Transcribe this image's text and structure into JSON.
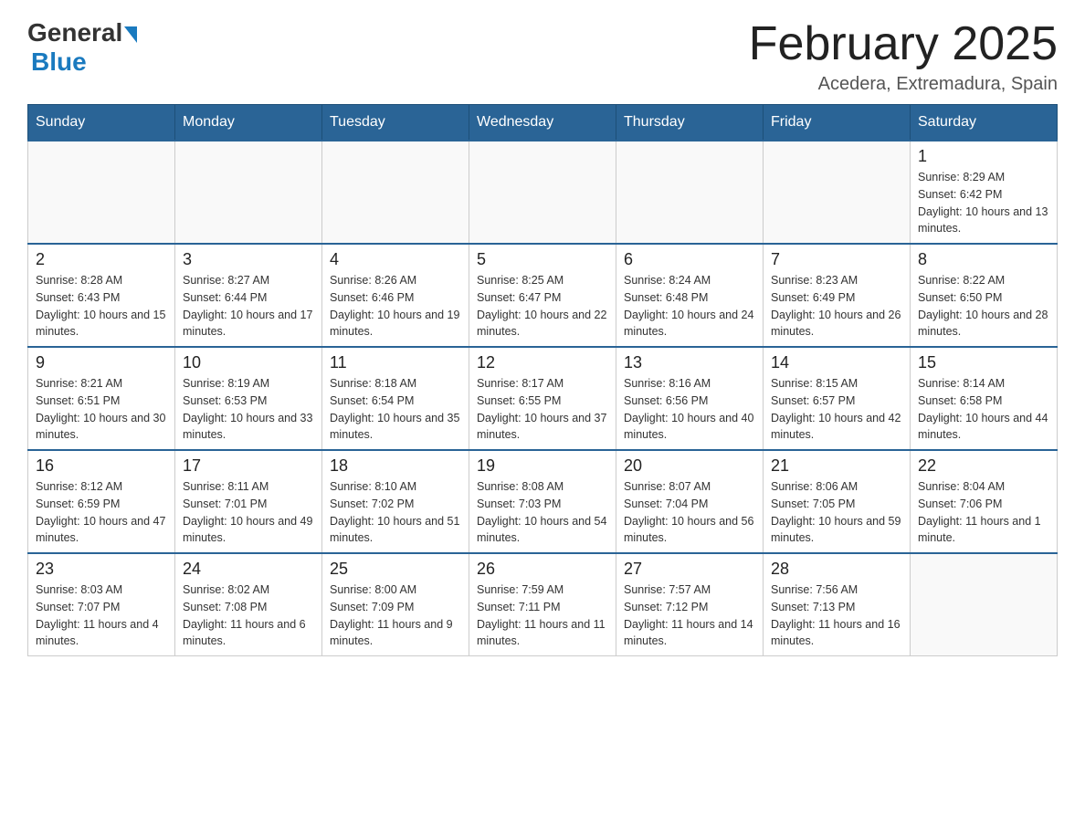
{
  "header": {
    "logo_general": "General",
    "logo_blue": "Blue",
    "title": "February 2025",
    "location": "Acedera, Extremadura, Spain"
  },
  "days_of_week": [
    "Sunday",
    "Monday",
    "Tuesday",
    "Wednesday",
    "Thursday",
    "Friday",
    "Saturday"
  ],
  "weeks": [
    [
      {
        "day": "",
        "info": ""
      },
      {
        "day": "",
        "info": ""
      },
      {
        "day": "",
        "info": ""
      },
      {
        "day": "",
        "info": ""
      },
      {
        "day": "",
        "info": ""
      },
      {
        "day": "",
        "info": ""
      },
      {
        "day": "1",
        "info": "Sunrise: 8:29 AM\nSunset: 6:42 PM\nDaylight: 10 hours and 13 minutes."
      }
    ],
    [
      {
        "day": "2",
        "info": "Sunrise: 8:28 AM\nSunset: 6:43 PM\nDaylight: 10 hours and 15 minutes."
      },
      {
        "day": "3",
        "info": "Sunrise: 8:27 AM\nSunset: 6:44 PM\nDaylight: 10 hours and 17 minutes."
      },
      {
        "day": "4",
        "info": "Sunrise: 8:26 AM\nSunset: 6:46 PM\nDaylight: 10 hours and 19 minutes."
      },
      {
        "day": "5",
        "info": "Sunrise: 8:25 AM\nSunset: 6:47 PM\nDaylight: 10 hours and 22 minutes."
      },
      {
        "day": "6",
        "info": "Sunrise: 8:24 AM\nSunset: 6:48 PM\nDaylight: 10 hours and 24 minutes."
      },
      {
        "day": "7",
        "info": "Sunrise: 8:23 AM\nSunset: 6:49 PM\nDaylight: 10 hours and 26 minutes."
      },
      {
        "day": "8",
        "info": "Sunrise: 8:22 AM\nSunset: 6:50 PM\nDaylight: 10 hours and 28 minutes."
      }
    ],
    [
      {
        "day": "9",
        "info": "Sunrise: 8:21 AM\nSunset: 6:51 PM\nDaylight: 10 hours and 30 minutes."
      },
      {
        "day": "10",
        "info": "Sunrise: 8:19 AM\nSunset: 6:53 PM\nDaylight: 10 hours and 33 minutes."
      },
      {
        "day": "11",
        "info": "Sunrise: 8:18 AM\nSunset: 6:54 PM\nDaylight: 10 hours and 35 minutes."
      },
      {
        "day": "12",
        "info": "Sunrise: 8:17 AM\nSunset: 6:55 PM\nDaylight: 10 hours and 37 minutes."
      },
      {
        "day": "13",
        "info": "Sunrise: 8:16 AM\nSunset: 6:56 PM\nDaylight: 10 hours and 40 minutes."
      },
      {
        "day": "14",
        "info": "Sunrise: 8:15 AM\nSunset: 6:57 PM\nDaylight: 10 hours and 42 minutes."
      },
      {
        "day": "15",
        "info": "Sunrise: 8:14 AM\nSunset: 6:58 PM\nDaylight: 10 hours and 44 minutes."
      }
    ],
    [
      {
        "day": "16",
        "info": "Sunrise: 8:12 AM\nSunset: 6:59 PM\nDaylight: 10 hours and 47 minutes."
      },
      {
        "day": "17",
        "info": "Sunrise: 8:11 AM\nSunset: 7:01 PM\nDaylight: 10 hours and 49 minutes."
      },
      {
        "day": "18",
        "info": "Sunrise: 8:10 AM\nSunset: 7:02 PM\nDaylight: 10 hours and 51 minutes."
      },
      {
        "day": "19",
        "info": "Sunrise: 8:08 AM\nSunset: 7:03 PM\nDaylight: 10 hours and 54 minutes."
      },
      {
        "day": "20",
        "info": "Sunrise: 8:07 AM\nSunset: 7:04 PM\nDaylight: 10 hours and 56 minutes."
      },
      {
        "day": "21",
        "info": "Sunrise: 8:06 AM\nSunset: 7:05 PM\nDaylight: 10 hours and 59 minutes."
      },
      {
        "day": "22",
        "info": "Sunrise: 8:04 AM\nSunset: 7:06 PM\nDaylight: 11 hours and 1 minute."
      }
    ],
    [
      {
        "day": "23",
        "info": "Sunrise: 8:03 AM\nSunset: 7:07 PM\nDaylight: 11 hours and 4 minutes."
      },
      {
        "day": "24",
        "info": "Sunrise: 8:02 AM\nSunset: 7:08 PM\nDaylight: 11 hours and 6 minutes."
      },
      {
        "day": "25",
        "info": "Sunrise: 8:00 AM\nSunset: 7:09 PM\nDaylight: 11 hours and 9 minutes."
      },
      {
        "day": "26",
        "info": "Sunrise: 7:59 AM\nSunset: 7:11 PM\nDaylight: 11 hours and 11 minutes."
      },
      {
        "day": "27",
        "info": "Sunrise: 7:57 AM\nSunset: 7:12 PM\nDaylight: 11 hours and 14 minutes."
      },
      {
        "day": "28",
        "info": "Sunrise: 7:56 AM\nSunset: 7:13 PM\nDaylight: 11 hours and 16 minutes."
      },
      {
        "day": "",
        "info": ""
      }
    ]
  ]
}
